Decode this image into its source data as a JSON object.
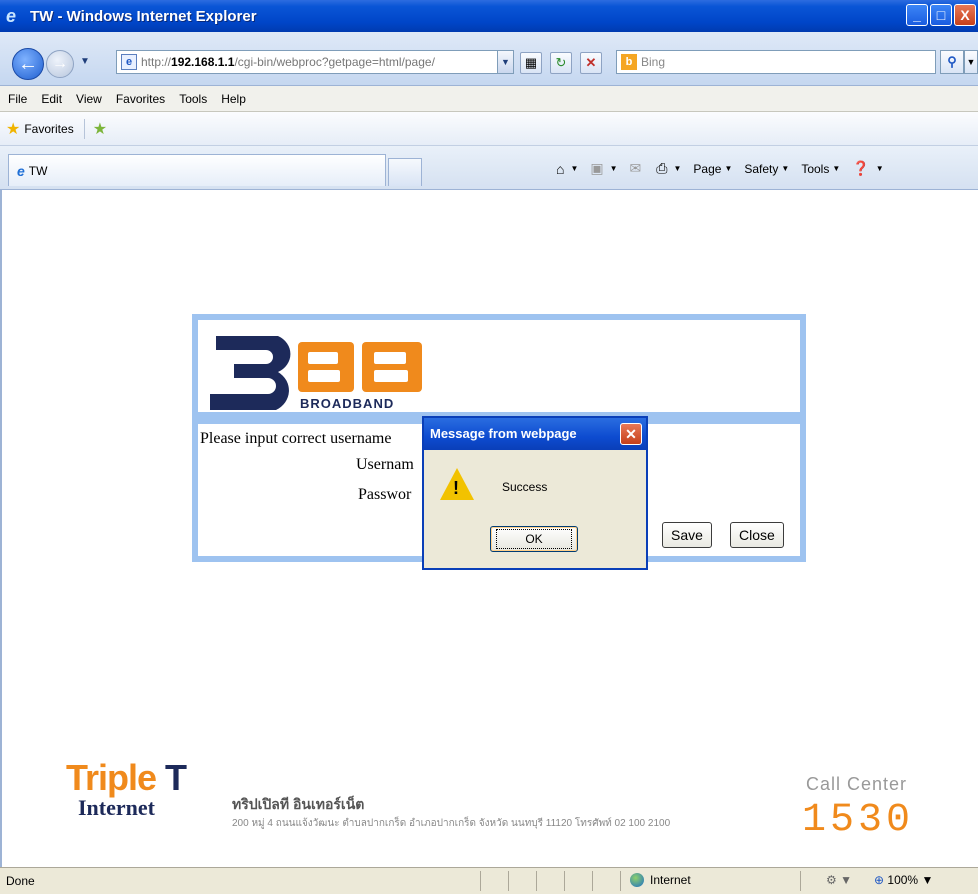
{
  "window": {
    "title": "TW - Windows Internet Explorer",
    "controls": [
      "_",
      "□",
      "X"
    ]
  },
  "address": {
    "url_prefix": "http://",
    "url_host": "192.168.1.1",
    "url_path": "/cgi-bin/webproc?getpage=html/page/",
    "search_placeholder": "Bing"
  },
  "menu": [
    "File",
    "Edit",
    "View",
    "Favorites",
    "Tools",
    "Help"
  ],
  "favorites_bar": {
    "label": "Favorites"
  },
  "tabs": [
    {
      "label": "TW"
    }
  ],
  "command_bar": {
    "page": "Page",
    "safety": "Safety",
    "tools": "Tools"
  },
  "logo": {
    "brand": "3BB",
    "sub": "BROADBAND"
  },
  "login": {
    "message": "Please input correct username",
    "username_label": "Usernam",
    "password_label": "Passwor",
    "save_label": "Save",
    "close_label": "Close"
  },
  "dialog": {
    "title": "Message from webpage",
    "text": "Success",
    "ok_label": "OK"
  },
  "footer": {
    "logo_top": "Triple T",
    "logo_bottom": "Internet",
    "company": "ทริปเปิลที อินเทอร์เน็ต",
    "address": "200 หมู่ 4 ถนนแจ้งวัฒนะ ตำบลปากเกร็ด อำเภอปากเกร็ด จังหวัด นนทบุรี 11120 โทรศัพท์ 02 100 2100",
    "call_center_label": "Call Center",
    "call_center_number": "1530"
  },
  "status": {
    "text": "Done",
    "zone": "Internet",
    "zoom": "100%"
  },
  "colors": {
    "titlebar": "#0a55d6",
    "frame": "#9ec3f0",
    "brand_blue": "#1d2a5a",
    "brand_orange": "#f08a1c"
  }
}
